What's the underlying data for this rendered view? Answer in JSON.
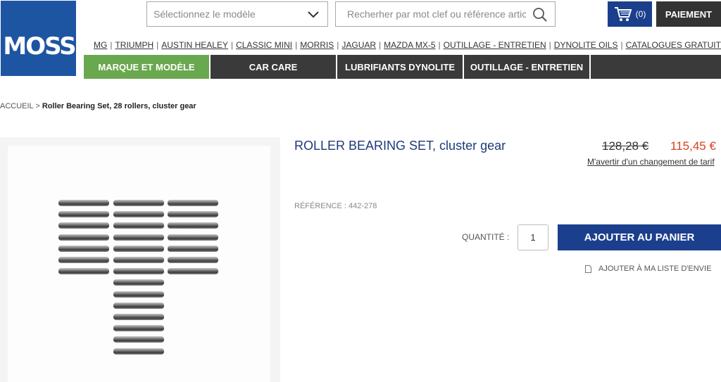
{
  "brand": {
    "logo_text": "MOSS"
  },
  "header": {
    "model_select": {
      "placeholder": "Sélectionnez le modèle"
    },
    "search": {
      "placeholder": "Recherher par mot clef ou référence article"
    },
    "cart": {
      "count": "(0)"
    },
    "pay_label": "PAIEMENT"
  },
  "top_links": [
    "MG",
    "TRIUMPH",
    "AUSTIN HEALEY",
    "CLASSIC MINI",
    "MORRIS",
    "JAGUAR",
    "MAZDA MX-5",
    "OUTILLAGE - ENTRETIEN",
    "DYNOLITE OILS",
    "CATALOGUES GRATUITS"
  ],
  "main_nav": [
    "MARQUE ET MODÈLE",
    "CAR CARE",
    "LUBRIFIANTS DYNOLITE",
    "OUTILLAGE - ENTRETIEN"
  ],
  "breadcrumb": {
    "home": "ACCUEIL",
    "separator": ">",
    "current": "Roller Bearing Set, 28 rollers, cluster gear"
  },
  "product": {
    "title": "ROLLER BEARING SET, cluster gear",
    "old_price": "128,28 €",
    "price": "115,45 €",
    "notify_label": "M'avertir d'un changement de tarif",
    "reference": "RÉFÉRENCE : 442-278",
    "quantity_label": "QUANTITÉ :",
    "quantity": "1",
    "add_to_cart": "AJOUTER AU PANIER",
    "wishlist_label": "AJOUTER À MA LISTE D'ENVIE"
  },
  "colors": {
    "brand_blue": "#1e55a3",
    "navy": "#1b3f8c",
    "nav_dark": "#3a3a3a",
    "nav_active": "#6aa84f",
    "price_red": "#d9411e"
  },
  "icons": {
    "cart": "shopping-cart-icon",
    "search": "magnifier-icon",
    "chevron": "chevron-down-icon",
    "wishlist": "document-icon"
  }
}
